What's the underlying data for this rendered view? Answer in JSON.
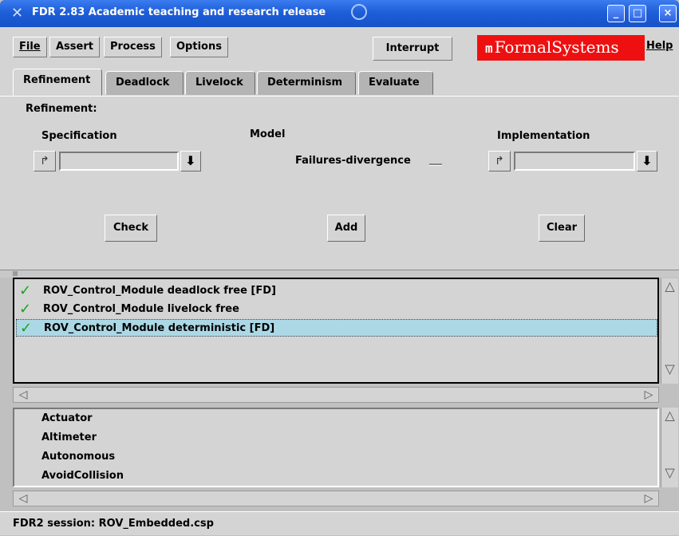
{
  "window": {
    "title": "FDR 2.83 Academic teaching and research release",
    "minimize_glyph": "_",
    "maximize_glyph": "□",
    "close_glyph": "×"
  },
  "menu": {
    "file": "File",
    "assert": "Assert",
    "process": "Process",
    "options": "Options",
    "interrupt": "Interrupt",
    "brand": "FormalSystems",
    "help": "Help"
  },
  "tabs": [
    "Refinement",
    "Deadlock",
    "Livelock",
    "Determinism",
    "Evaluate"
  ],
  "active_tab": "Refinement",
  "refinement": {
    "section_label": "Refinement:",
    "spec_label": "Specification",
    "model_label": "Model",
    "model_value": "Failures-divergence",
    "impl_label": "Implementation",
    "spec_value": "",
    "impl_value": "",
    "check_button": "Check",
    "add_button": "Add",
    "clear_button": "Clear"
  },
  "results": [
    {
      "status": "passed",
      "text": "ROV_Control_Module deadlock free [FD]",
      "selected": false
    },
    {
      "status": "passed",
      "text": "ROV_Control_Module livelock free",
      "selected": false
    },
    {
      "status": "passed",
      "text": "ROV_Control_Module deterministic [FD]",
      "selected": true
    }
  ],
  "processes": [
    "Actuator",
    "Altimeter",
    "Autonomous",
    "AvoidCollision"
  ],
  "status_bar": "FDR2 session: ROV_Embedded.csp",
  "colors": {
    "title_bar": "#1e5ed8",
    "brand_bg": "#ee1010",
    "selection": "#acd8e6",
    "check_green": "#1aa01a",
    "panel": "#d4d4d4"
  },
  "icons": {
    "check": "✓",
    "drop_down": "⬇",
    "jump": "↱"
  }
}
